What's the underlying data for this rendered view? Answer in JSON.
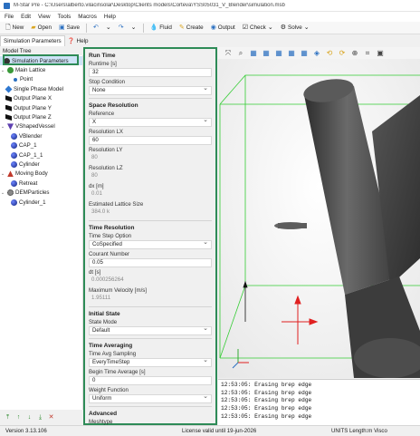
{
  "window": {
    "title": "M-Star Pre - C:\\Users\\alberto.vilacinsolar\\Desktop\\Clients models\\Corteva\\YSS05031_V_Blender\\simulation.msb"
  },
  "menu": [
    "File",
    "Edit",
    "View",
    "Tools",
    "Macros",
    "Help"
  ],
  "toolbar": {
    "new": "New",
    "open": "Open",
    "save": "Save",
    "fluid": "Fluid",
    "create": "Create",
    "output": "Output",
    "check": "Check",
    "solve": "Solve"
  },
  "tabs": {
    "sim_params": "Simulation Parameters",
    "help": "Help"
  },
  "tree": {
    "heading": "Model Tree",
    "items": [
      {
        "label": "Simulation Parameters",
        "icon": "gear-icon"
      },
      {
        "label": "Main Lattice",
        "icon": "lattice-icon"
      },
      {
        "label": "Point",
        "icon": "point-icon"
      },
      {
        "label": "Single Phase Model",
        "icon": "phase-icon"
      },
      {
        "label": "Output Plane X",
        "icon": "plane-icon"
      },
      {
        "label": "Output Plane Y",
        "icon": "plane-icon"
      },
      {
        "label": "Output Plane Z",
        "icon": "plane-icon"
      },
      {
        "label": "VShapedVessel",
        "icon": "vessel-icon"
      },
      {
        "label": "VBlender",
        "icon": "sphere-icon"
      },
      {
        "label": "CAP_1",
        "icon": "sphere-icon"
      },
      {
        "label": "CAP_1_1",
        "icon": "sphere-icon"
      },
      {
        "label": "Cylinder",
        "icon": "sphere-icon"
      },
      {
        "label": "Moving Body",
        "icon": "body-icon"
      },
      {
        "label": "Retreat",
        "icon": "sphere-icon"
      },
      {
        "label": "DEMParticles",
        "icon": "dem-icon"
      },
      {
        "label": "Cylinder_1",
        "icon": "sphere-icon"
      }
    ]
  },
  "params": {
    "run_time": {
      "section": "Run Time",
      "runtime_label": "Runtime [s]",
      "runtime_value": "32",
      "stop_label": "Stop Condition",
      "stop_value": "None"
    },
    "space": {
      "section": "Space Resolution",
      "reference_label": "Reference",
      "reference_value": "X",
      "lx_label": "Resolution LX",
      "lx_value": "60",
      "ly_label": "Resolution LY",
      "ly_value": "80",
      "lz_label": "Resolution LZ",
      "lz_value": "80",
      "dx_label": "dx [m]",
      "dx_value": "0.01",
      "lattice_label": "Estimated Lattice Size",
      "lattice_value": "384.0 k"
    },
    "time": {
      "section": "Time Resolution",
      "option_label": "Time Step Option",
      "option_value": "CoSpecified",
      "courant_label": "Courant Number",
      "courant_value": "0.05",
      "dt_label": "dt [s]",
      "dt_value": "0.000256264",
      "vmax_label": "Maximum Velocity [m/s]",
      "vmax_value": "1.95111"
    },
    "initial": {
      "section": "Initial State",
      "mode_label": "State Mode",
      "mode_value": "Default"
    },
    "averaging": {
      "section": "Time Averaging",
      "sampling_label": "Time Avg Sampling",
      "sampling_value": "EveryTimeStep",
      "begin_label": "Begin Time Average [s]",
      "begin_value": "0",
      "weight_label": "Weight Function",
      "weight_value": "Uniform"
    },
    "advanced": {
      "section": "Advanced",
      "meshtype_label": "Meshtype"
    }
  },
  "log": [
    "12:53:05: Erasing brep edge",
    "12:53:05: Erasing brep edge",
    "12:53:05: Erasing brep edge",
    "12:53:05: Erasing brep edge",
    "12:53:05: Erasing brep edge"
  ],
  "status": {
    "version": "Version 3.13.106",
    "license": "License valid until 19-jun-2026",
    "units": "UNITS Length:m Visco"
  },
  "colors": {
    "highlight": "#2e8b57",
    "bbox": "#33cc33",
    "cylinder": "#4a4a4a",
    "axis_red": "#e02020"
  }
}
